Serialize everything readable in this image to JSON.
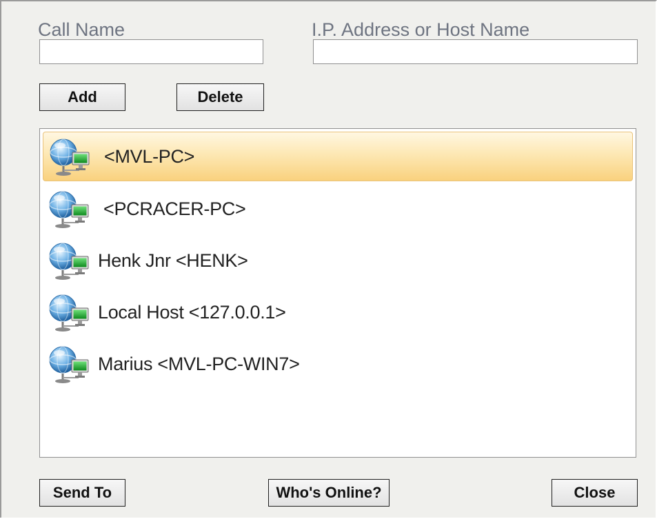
{
  "form": {
    "call_name_label": "Call Name",
    "call_name_value": "",
    "host_label": "I.P. Address or Host Name",
    "host_value": "",
    "add_label": "Add",
    "delete_label": "Delete"
  },
  "contacts": [
    {
      "label": "<MVL-PC>",
      "selected": true,
      "icon": "network-computer-icon"
    },
    {
      "label": "<PCRACER-PC>",
      "selected": false,
      "icon": "network-computer-icon"
    },
    {
      "label": "Henk Jnr <HENK>",
      "selected": false,
      "icon": "network-computer-icon"
    },
    {
      "label": "Local Host <127.0.0.1>",
      "selected": false,
      "icon": "network-computer-icon"
    },
    {
      "label": "Marius <MVL-PC-WIN7>",
      "selected": false,
      "icon": "network-computer-icon"
    }
  ],
  "footer": {
    "send_to_label": "Send To",
    "whos_online_label": "Who's Online?",
    "close_label": "Close"
  },
  "colors": {
    "dialog_bg": "#f0f0ed",
    "label_text": "#6e7481",
    "selection_top": "#fff7e2",
    "selection_bottom": "#f9d17e"
  }
}
